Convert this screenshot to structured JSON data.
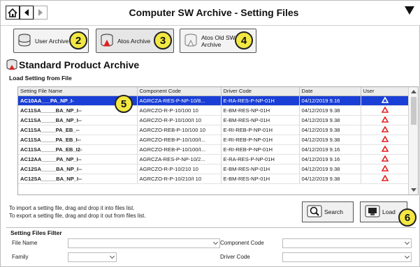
{
  "window": {
    "title": "Computer SW Archive - Setting Files"
  },
  "archive_buttons": [
    {
      "label": "User Archive",
      "badge": "2"
    },
    {
      "label": "Atos Archive",
      "badge": "3"
    },
    {
      "label": "Atos Old SW Archive",
      "badge": "4"
    }
  ],
  "section": {
    "title": "Standard Product Archive",
    "subtitle": "Load Setting from File"
  },
  "table": {
    "columns": [
      "Setting File Name",
      "Component Code",
      "Driver Code",
      "Date",
      "User"
    ],
    "rows": [
      {
        "name": "AC10AA___PA_NP_I-",
        "component": "AGRCZA-RES-P-NP-10/8...",
        "driver": "E-RA-RES-P-NP-01H",
        "date": "04/12/2019 9.16",
        "selected": true
      },
      {
        "name": "AC11SA_____BA_NP_I--",
        "component": "AGRCZO-R-P-10/100 10",
        "driver": "E-BM-RES-NP-01H",
        "date": "04/12/2019 9.38",
        "selected": false
      },
      {
        "name": "AC11SA_____BA_NP_I--",
        "component": "AGRCZO-R-P-10/100/I 10",
        "driver": "E-BM-RES-NP-01H",
        "date": "04/12/2019 9.38",
        "selected": false
      },
      {
        "name": "AC11SA_____PA_EB_--",
        "component": "AGRCZO-REB-P-10/100 10",
        "driver": "E-RI-REB-P-NP-01H",
        "date": "04/12/2019 9.38",
        "selected": false
      },
      {
        "name": "AC11SA_____PA_EB_I--",
        "component": "AGRCZO-REB-P-10/100/I...",
        "driver": "E-RI-REB-P-NP-01H",
        "date": "04/12/2019 9.38",
        "selected": false
      },
      {
        "name": "AC11SA_____PA_EB_I2-",
        "component": "AGRCZO-REB-P-10/100/I...",
        "driver": "E-RI-REB-P-NP-01H",
        "date": "04/12/2019 9.16",
        "selected": false
      },
      {
        "name": "AC12AA_____PA_NP_I--",
        "component": "AGRCZA-RES-P-NP-10/2...",
        "driver": "E-RA-RES-P-NP-01H",
        "date": "04/12/2019 9.16",
        "selected": false
      },
      {
        "name": "AC12SA_____BA_NP_I--",
        "component": "AGRCZO-R-P-10/210 10",
        "driver": "E-BM-RES-NP-01H",
        "date": "04/12/2019 9.38",
        "selected": false
      },
      {
        "name": "AC12SA_____BA_NP_I--",
        "component": "AGRCZO-R-P-10/210/I 10",
        "driver": "E-BM-RES-NP-01H",
        "date": "04/12/2019 9.38",
        "selected": false
      }
    ],
    "badge": "5"
  },
  "instructions": {
    "line1": "To import a setting file, drag and drop it into files list.",
    "line2": "To export a setting file, drag and drop it out from files list."
  },
  "actions": {
    "search_label": "Search",
    "load_label": "Load",
    "load_badge": "6"
  },
  "filter": {
    "title": "Setting Files Filter",
    "file_name_label": "File Name",
    "component_code_label": "Component Code",
    "family_label": "Family",
    "driver_code_label": "Driver Code"
  },
  "colors": {
    "selection": "#1a3fd6",
    "badge": "#f3e843",
    "warning_icon": "#e02020"
  }
}
